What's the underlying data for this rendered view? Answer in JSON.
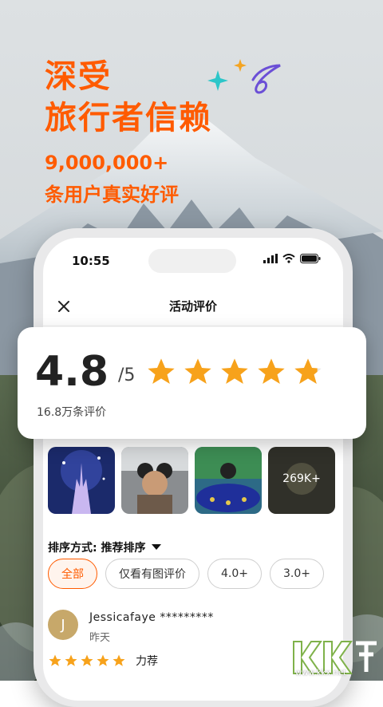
{
  "headline": {
    "line1": "深受",
    "line2": "旅行者信赖",
    "line3": "9,000,000+",
    "line4": "条用户真实好评"
  },
  "status_bar": {
    "time": "10:55"
  },
  "nav": {
    "title": "活动评价"
  },
  "rating": {
    "score": "4.8",
    "max": "/5",
    "count": "16.8万条评价",
    "stars": 4.8
  },
  "photos": {
    "more_count": "269K+"
  },
  "sort": {
    "label": "排序方式: 推荐排序"
  },
  "filters": [
    "全部",
    "仅看有图评价",
    "4.0+",
    "3.0+"
  ],
  "review": {
    "avatar_initial": "J",
    "name": "Jessicafaye *********",
    "date": "昨天",
    "tag": "力荐",
    "stars": 5
  },
  "watermark": {
    "text": "www.kkx.net"
  },
  "colors": {
    "accent": "#ff5b00",
    "star": "#f7a21b"
  }
}
